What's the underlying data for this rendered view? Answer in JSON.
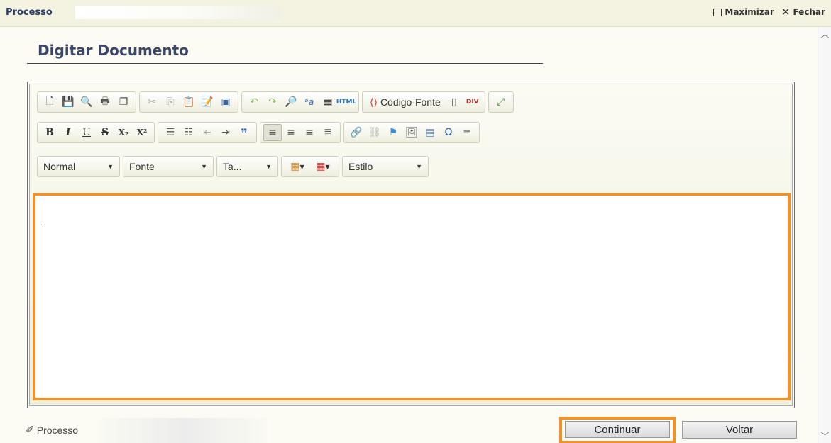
{
  "window": {
    "title": "Processo",
    "maximize_label": "Maximizar",
    "close_label": "Fechar"
  },
  "page": {
    "heading": "Digitar Documento"
  },
  "editor": {
    "toolbar_row1": {
      "source_label": "Código-Fonte"
    },
    "combos": {
      "format": "Normal",
      "font": "Fonte",
      "size": "Ta...",
      "style": "Estilo"
    },
    "content": ""
  },
  "footer": {
    "process_link": "Processo",
    "continue_label": "Continuar",
    "back_label": "Voltar"
  },
  "colors": {
    "accent": "#f0922b",
    "titlebar": "#f4f3e1",
    "heading": "#3a4769"
  }
}
